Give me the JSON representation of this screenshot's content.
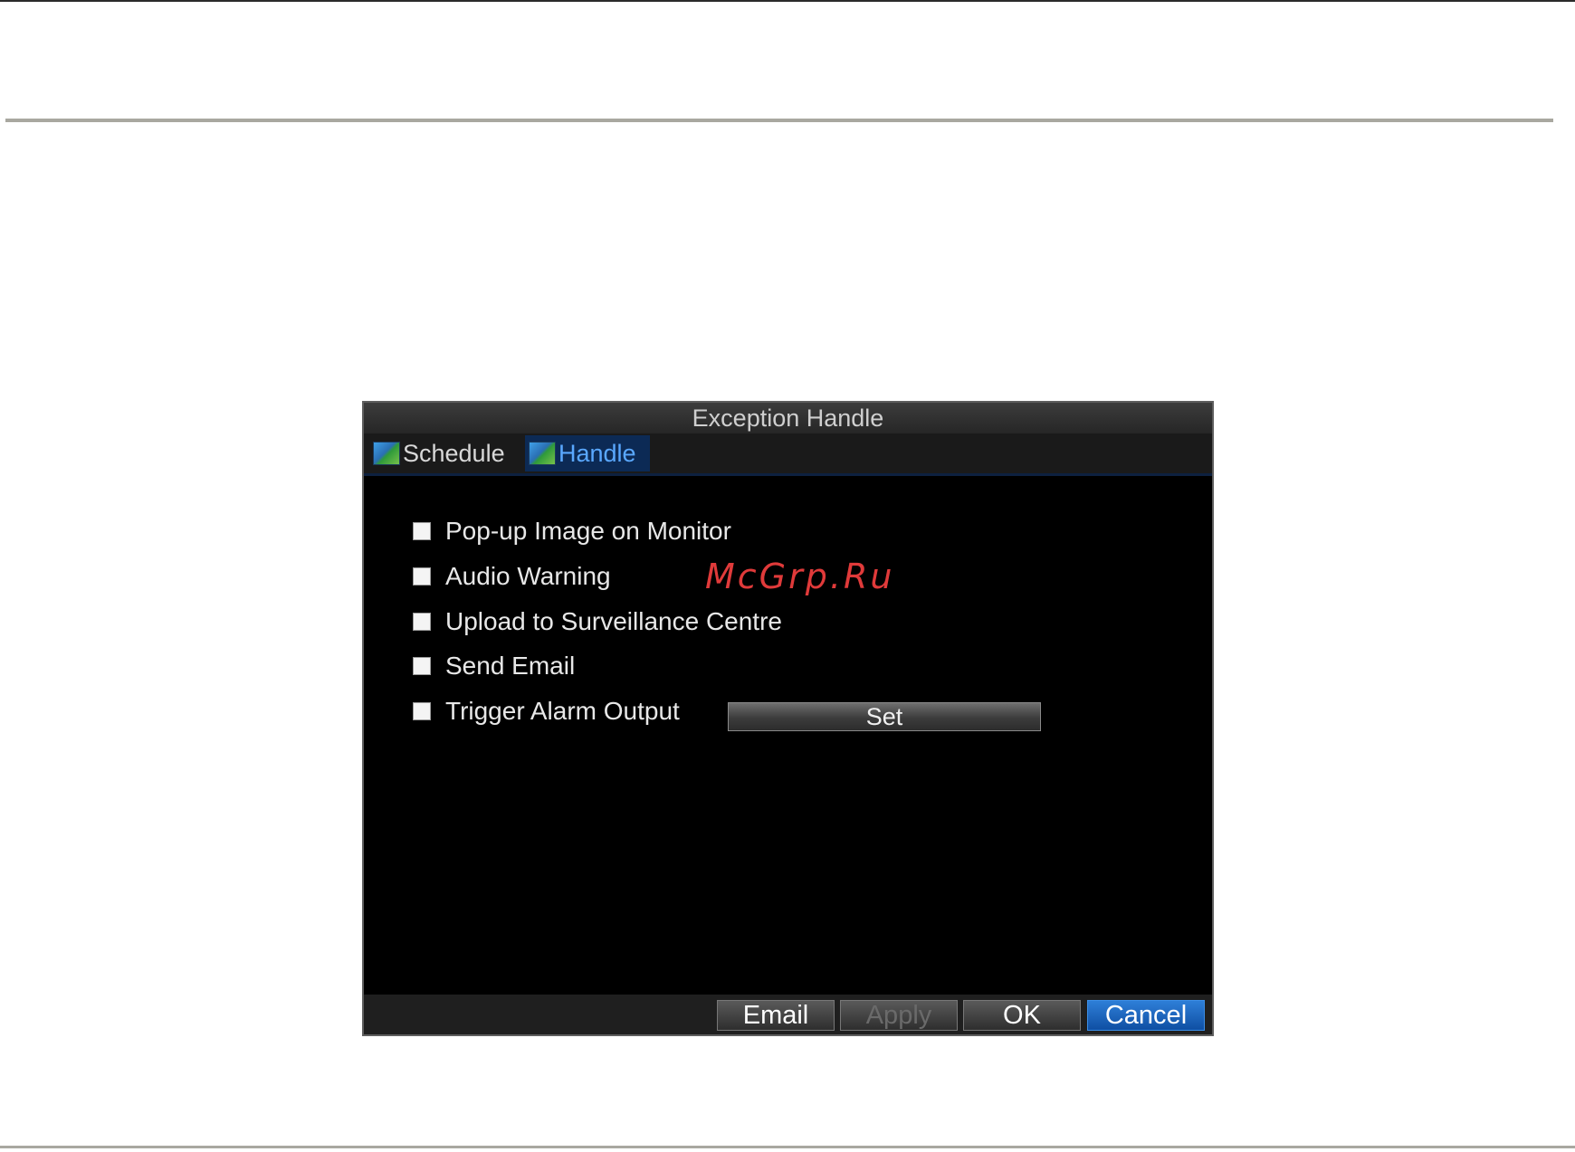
{
  "dialog": {
    "title": "Exception Handle",
    "tabs": [
      {
        "label": "Schedule",
        "icon": "image-icon",
        "active": false
      },
      {
        "label": "Handle",
        "icon": "image-icon",
        "active": true
      }
    ],
    "options": [
      {
        "label": "Pop-up Image on Monitor",
        "checked": false
      },
      {
        "label": "Audio Warning",
        "checked": false
      },
      {
        "label": "Upload to Surveillance Centre",
        "checked": false
      },
      {
        "label": "Send Email",
        "checked": false
      },
      {
        "label": "Trigger Alarm Output",
        "checked": false
      }
    ],
    "set_label": "Set",
    "buttons": {
      "email": "Email",
      "apply": "Apply",
      "ok": "OK",
      "cancel": "Cancel"
    }
  },
  "watermark": "McGrp.Ru",
  "colors": {
    "active_tab": "#0c2a55",
    "active_tab_text": "#5aa8ff",
    "cancel_button": "#1a63c0",
    "watermark": "#e03a3a"
  }
}
